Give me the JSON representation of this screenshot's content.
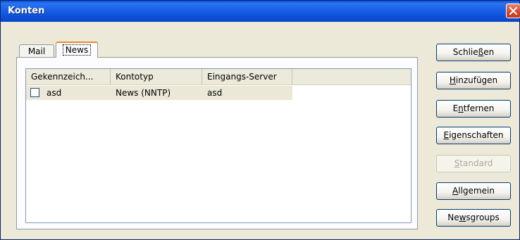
{
  "window": {
    "title": "Konten"
  },
  "tabs": [
    {
      "label": "Mail"
    },
    {
      "label": "News"
    }
  ],
  "list": {
    "columns": [
      "Gekennzeich...",
      "Kontotyp",
      "Eingangs-Server"
    ],
    "rows": [
      {
        "checked": false,
        "name": "asd",
        "type": "News (NNTP)",
        "server": "asd"
      }
    ]
  },
  "buttons": {
    "close": {
      "pre": "Schlie",
      "acc": "ß",
      "post": "en"
    },
    "add": {
      "pre": "",
      "acc": "H",
      "post": "inzufügen"
    },
    "remove": {
      "pre": "E",
      "acc": "n",
      "post": "tfernen"
    },
    "props": {
      "pre": "",
      "acc": "E",
      "post": "igenschaften"
    },
    "default": {
      "pre": "",
      "acc": "S",
      "post": "tandard"
    },
    "general": {
      "pre": "",
      "acc": "A",
      "post": "llgemein"
    },
    "groups": {
      "pre": "Ne",
      "acc": "w",
      "post": "sgroups"
    }
  }
}
